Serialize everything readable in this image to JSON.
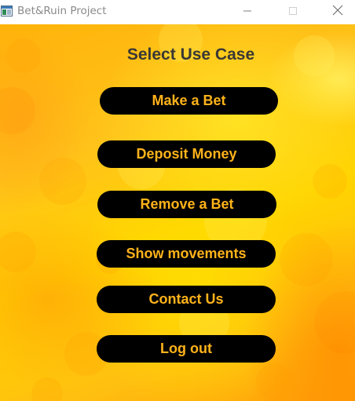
{
  "window": {
    "title": "Bet&Ruin Project",
    "icon": "app-window-icon",
    "controls": [
      "minimize-icon",
      "maximize-icon",
      "close-icon"
    ]
  },
  "main": {
    "heading": "Select Use Case",
    "buttons": [
      {
        "label": "Make a Bet"
      },
      {
        "label": "Deposit Money"
      },
      {
        "label": "Remove a Bet"
      },
      {
        "label": "Show movements"
      },
      {
        "label": "Contact Us"
      },
      {
        "label": "Log out"
      }
    ]
  },
  "colors": {
    "button_background": "#000000",
    "button_text": "#ffb31a",
    "heading_text": "#3a3835",
    "background": "#ffc21a"
  }
}
